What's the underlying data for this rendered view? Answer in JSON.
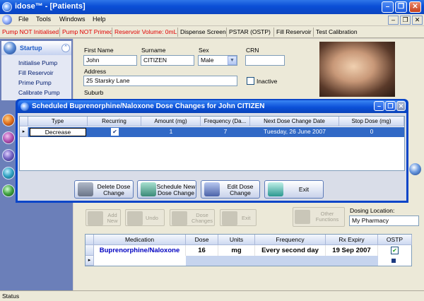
{
  "window": {
    "title": "idose™ - [Patients]"
  },
  "menu": {
    "items": [
      "File",
      "Tools",
      "Windows",
      "Help"
    ]
  },
  "toolbar": {
    "items": [
      {
        "label": "Pump NOT Initialised",
        "color": "#e00000"
      },
      {
        "label": "Pump NOT Primed",
        "color": "#e00000"
      },
      {
        "label": "Reservoir Volume: 0mL",
        "color": "#e00000"
      },
      {
        "label": "Dispense Screen",
        "color": "#000000"
      },
      {
        "label": "PSTAR (OSTP)",
        "color": "#000000"
      },
      {
        "label": "Fill Reservoir",
        "color": "#000000"
      },
      {
        "label": "Test Calibration",
        "color": "#000000"
      }
    ]
  },
  "sidebar": {
    "header": "Startup",
    "links": [
      "Initialise Pump",
      "Fill Reservoir",
      "Prime Pump",
      "Calibrate Pump"
    ]
  },
  "patient": {
    "first_name_label": "First Name",
    "first_name": "John",
    "surname_label": "Surname",
    "surname": "CITIZEN",
    "sex_label": "Sex",
    "sex": "Male",
    "crn_label": "CRN",
    "crn": "",
    "address_label": "Address",
    "address": "25 Starsky Lane",
    "inactive_label": "Inactive",
    "suburb_label": "Suburb"
  },
  "background_toolbar": {
    "buttons": [
      "Add New",
      "Undo",
      "Dose Changes",
      "Exit",
      "Other Functions"
    ],
    "dosing_location_label": "Dosing Location:",
    "dosing_location": "My Pharmacy"
  },
  "medications": {
    "columns": [
      "Medication",
      "Dose",
      "Units",
      "Frequency",
      "Rx Expiry",
      "OSTP"
    ],
    "rows": [
      {
        "medication": "Buprenorphine/Naloxone",
        "dose": "16",
        "units": "mg",
        "frequency": "Every second day",
        "rx_expiry": "19 Sep 2007",
        "ostp": true
      }
    ]
  },
  "dialog": {
    "title": "Scheduled Buprenorphine/Naloxone Dose Changes for John CITIZEN",
    "columns": [
      "Type",
      "Recurring",
      "Amount (mg)",
      "Frequency (Da...",
      "Next Dose Change Date",
      "Stop Dose (mg)"
    ],
    "rows": [
      {
        "type": "Decrease",
        "recurring": true,
        "amount": "1",
        "frequency": "7",
        "next_date": "Tuesday, 26 June 2007",
        "stop_dose": "0"
      }
    ],
    "buttons": {
      "delete": "Delete Dose Change",
      "schedule": "Schedule New Dose Change",
      "edit": "Edit Dose Change",
      "exit": "Exit"
    }
  },
  "status": {
    "text": "Status"
  }
}
